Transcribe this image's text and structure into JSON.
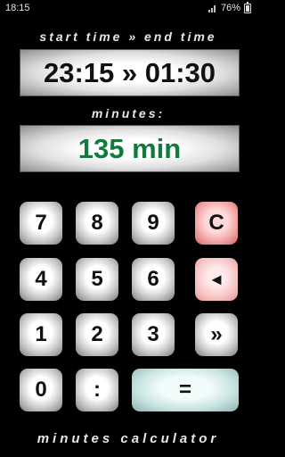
{
  "status_bar": {
    "time": "18:15",
    "battery": "76%",
    "signal_icon": "signal-icon",
    "battery_icon": "battery-icon"
  },
  "header": {
    "label": "start time » end time"
  },
  "time_display": {
    "value": "23:15 » 01:30"
  },
  "minutes_label": {
    "label": "minutes:"
  },
  "result_display": {
    "value": "135 min",
    "color": "#127a3c"
  },
  "keypad": {
    "k7": "7",
    "k8": "8",
    "k9": "9",
    "clear": "C",
    "k4": "4",
    "k5": "5",
    "k6": "6",
    "backspace": "◄",
    "k1": "1",
    "k2": "2",
    "k3": "3",
    "separator": "»",
    "k0": "0",
    "colon": ":",
    "equals": "="
  },
  "footer": {
    "label": "minutes calculator"
  },
  "colors": {
    "clear_key": "#f2a5a5",
    "backspace_key": "#f7c3c3",
    "equals_key": "#c7e3e1"
  }
}
